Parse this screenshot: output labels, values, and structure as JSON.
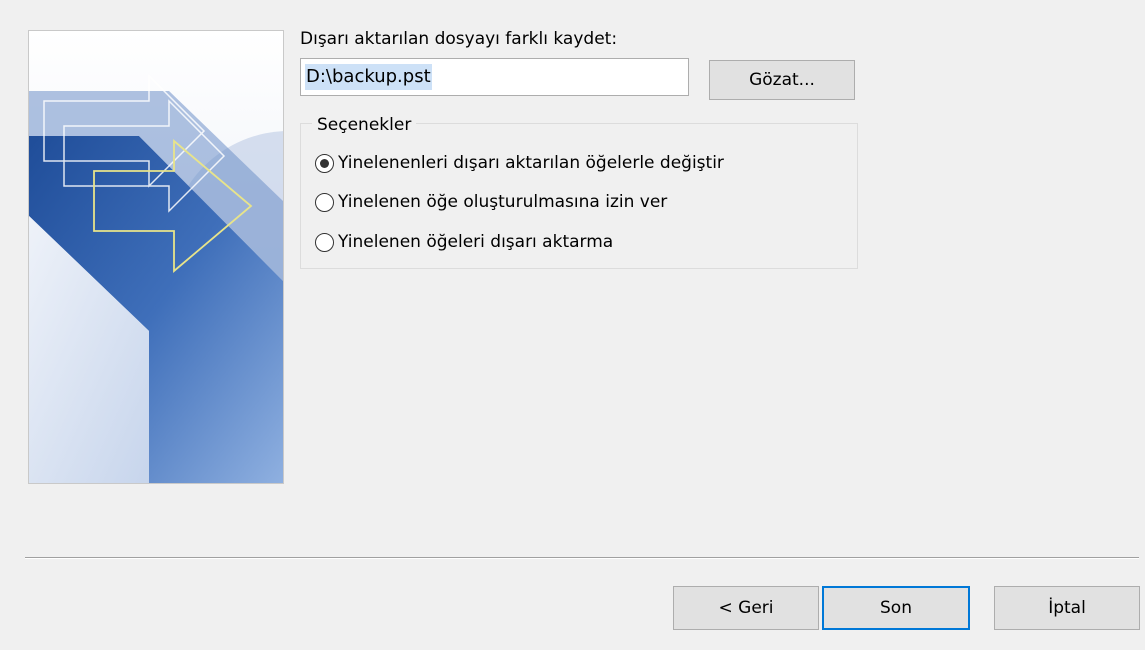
{
  "export": {
    "save_as_label": "Dışarı aktarılan dosyayı farklı kaydet:",
    "file_path": "D:\\backup.pst",
    "browse_label": "Gözat..."
  },
  "options": {
    "legend": "Seçenekler",
    "items": [
      {
        "label": "Yinelenenleri dışarı aktarılan öğelerle değiştir",
        "selected": true
      },
      {
        "label": "Yinelenen öğe oluşturulmasına izin ver",
        "selected": false
      },
      {
        "label": "Yinelenen öğeleri dışarı aktarma",
        "selected": false
      }
    ]
  },
  "footer": {
    "back_label": "< Geri",
    "finish_label": "Son",
    "cancel_label": "İptal"
  },
  "colors": {
    "dialog_background": "#f0f0f0",
    "selection_highlight": "#cde1f7",
    "default_button_border": "#0078d7"
  }
}
